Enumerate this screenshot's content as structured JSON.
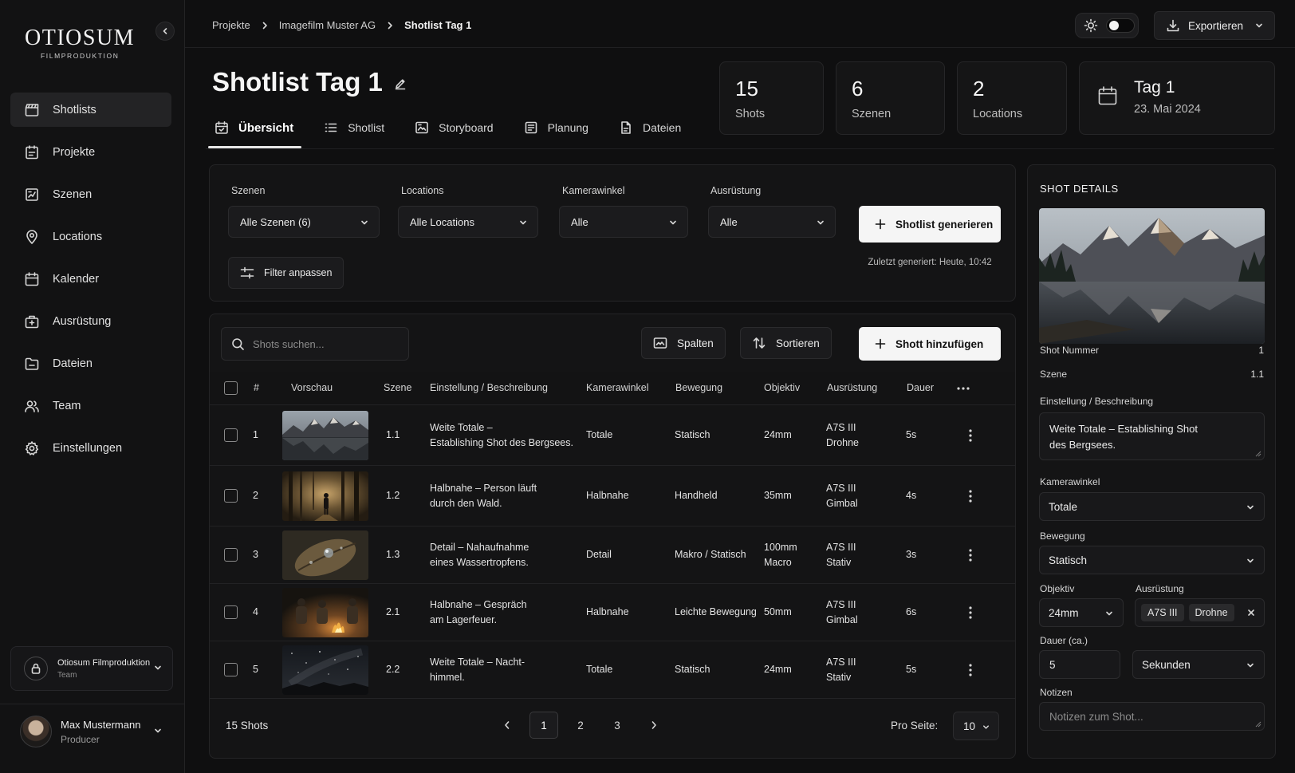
{
  "brand": {
    "name": "OTIOSUM",
    "sub": "FILMPRODUKTION"
  },
  "sidebar": {
    "items": [
      {
        "label": "Shotlists",
        "icon": "clapperboard-icon",
        "active": true
      },
      {
        "label": "Projekte",
        "icon": "project-folder-icon"
      },
      {
        "label": "Szenen",
        "icon": "scenes-icon"
      },
      {
        "label": "Locations",
        "icon": "map-pin-icon"
      },
      {
        "label": "Kalender",
        "icon": "calendar-icon"
      },
      {
        "label": "Ausrüstung",
        "icon": "camera-case-icon"
      },
      {
        "label": "Dateien",
        "icon": "folder-icon"
      },
      {
        "label": "Team",
        "icon": "users-icon"
      },
      {
        "label": "Einstellungen",
        "icon": "gear-icon"
      }
    ],
    "org": {
      "name": "Otiosum Filmproduktion",
      "role": "Team"
    },
    "user": {
      "name": "Max Mustermann",
      "role": "Producer"
    }
  },
  "breadcrumb": {
    "items": [
      "Projekte",
      "Imagefilm Muster AG"
    ],
    "current": "Shotlist Tag 1"
  },
  "header": {
    "export_label": "Exportieren"
  },
  "page": {
    "title": "Shotlist Tag 1"
  },
  "tabs": [
    {
      "label": "Übersicht",
      "icon": "calendar-check-icon",
      "active": true
    },
    {
      "label": "Shotlist",
      "icon": "list-icon"
    },
    {
      "label": "Storyboard",
      "icon": "storyboard-icon"
    },
    {
      "label": "Planung",
      "icon": "planning-icon"
    },
    {
      "label": "Dateien",
      "icon": "file-icon"
    }
  ],
  "stats": [
    {
      "value": "15",
      "label": "Shots"
    },
    {
      "value": "6",
      "label": "Szenen"
    },
    {
      "value": "2",
      "label": "Locations"
    }
  ],
  "day": {
    "title": "Tag 1",
    "date": "23. Mai 2024"
  },
  "filters": {
    "scenes_label": "Szenen",
    "scenes_value": "Alle Szenen (6)",
    "locations_label": "Locations",
    "locations_value": "Alle Locations",
    "angle_label": "Kamerawinkel",
    "angle_value": "Alle",
    "equipment_label": "Ausrüstung",
    "equipment_value": "Alle",
    "generate_label": "Shotlist generieren",
    "last_generated": "Zuletzt generiert: Heute, 10:42",
    "adjust_label": "Filter anpassen"
  },
  "toolbar": {
    "search_placeholder": "Shots suchen...",
    "columns_label": "Spalten",
    "sort_label": "Sortieren",
    "add_label": "Shott hinzufügen"
  },
  "table": {
    "headers": [
      "#",
      "Vorschau",
      "Szene",
      "Einstellung / Beschreibung",
      "Kamerawinkel",
      "Bewegung",
      "Objektiv",
      "Ausrüstung",
      "Dauer"
    ],
    "rows": [
      {
        "num": "1",
        "scene": "1.1",
        "desc1": "Weite Totale –",
        "desc2": "Establishing Shot des Bergsees.",
        "angle": "Totale",
        "move": "Statisch",
        "lens1": "24mm",
        "lens2": "",
        "equip1": "A7S III",
        "equip2": "Drohne",
        "dur": "5s",
        "thumb": "mountain-lake-thumbnail"
      },
      {
        "num": "2",
        "scene": "1.2",
        "desc1": "Halbnahe – Person läuft",
        "desc2": "durch den Wald.",
        "angle": "Halbnahe",
        "move": "Handheld",
        "lens1": "35mm",
        "lens2": "",
        "equip1": "A7S III",
        "equip2": "Gimbal",
        "dur": "4s",
        "thumb": "forest-walk-thumbnail"
      },
      {
        "num": "3",
        "scene": "1.3",
        "desc1": "Detail – Nahaufnahme",
        "desc2": "eines Wassertropfens.",
        "angle": "Detail",
        "move": "Makro / Statisch",
        "lens1": "100mm",
        "lens2": "Macro",
        "equip1": "A7S III",
        "equip2": "Stativ",
        "dur": "3s",
        "thumb": "water-drop-thumbnail"
      },
      {
        "num": "4",
        "scene": "2.1",
        "desc1": "Halbnahe – Gespräch",
        "desc2": "am Lagerfeuer.",
        "angle": "Halbnahe",
        "move": "Leichte Bewegung",
        "lens1": "50mm",
        "lens2": "",
        "equip1": "A7S III",
        "equip2": "Gimbal",
        "dur": "6s",
        "thumb": "campfire-thumbnail"
      },
      {
        "num": "5",
        "scene": "2.2",
        "desc1": "Weite Totale – Nacht-",
        "desc2": "himmel.",
        "angle": "Totale",
        "move": "Statisch",
        "lens1": "24mm",
        "lens2": "",
        "equip1": "A7S III",
        "equip2": "Stativ",
        "dur": "5s",
        "thumb": "night-sky-thumbnail"
      }
    ],
    "footer": {
      "count": "15 Shots",
      "pages": [
        "1",
        "2",
        "3"
      ],
      "current_page": "1",
      "per_page_label": "Pro Seite:",
      "per_page": "10"
    }
  },
  "details": {
    "title": "SHOT DETAILS",
    "shot_number_label": "Shot Nummer",
    "shot_number": "1",
    "scene_label": "Szene",
    "scene": "1.1",
    "desc_label": "Einstellung / Beschreibung",
    "desc_line1": "Weite Totale – Establishing Shot",
    "desc_line2": "des Bergsees.",
    "angle_label": "Kamerawinkel",
    "angle": "Totale",
    "move_label": "Bewegung",
    "move": "Statisch",
    "lens_label": "Objektiv",
    "lens": "24mm",
    "equip_label": "Ausrüstung",
    "equip_tags": [
      "A7S III",
      "Drohne"
    ],
    "duration_label": "Dauer (ca.)",
    "duration": "5",
    "duration_unit": "Sekunden",
    "notes_label": "Notizen",
    "notes_placeholder": "Notizen zum Shot..."
  }
}
